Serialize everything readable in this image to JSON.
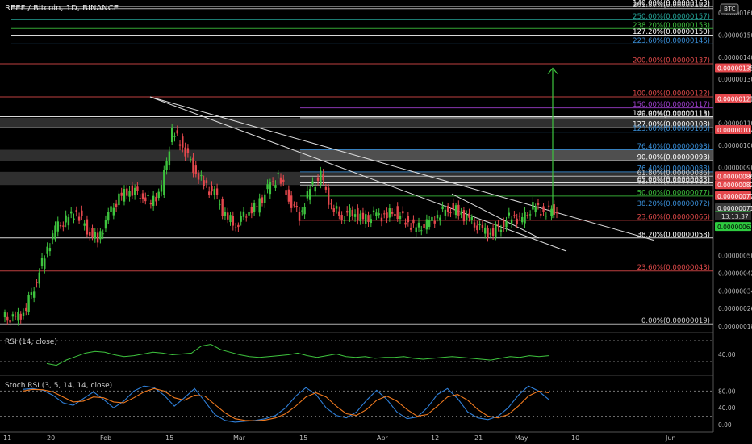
{
  "header": {
    "symbol": "REEF / Bitcoin, 1D, BINANCE",
    "currency": "BTC",
    "countdown": "13:13:37"
  },
  "colors": {
    "background": "#000000",
    "up": "#26a69a",
    "upBright": "#3ec43e",
    "down": "#e5484d",
    "fib": "#e04a4a",
    "rsi": "#3ec43e",
    "stochK": "#2f7fd8",
    "stochD": "#f07a1f",
    "target": "#3ec43e"
  },
  "chart_data": [
    {
      "type": "candlestick",
      "title": "REEF / Bitcoin, 1D, BINANCE",
      "xlabels": [
        "11",
        "20",
        "Feb",
        "15",
        "Mar",
        "15",
        "Apr",
        "12",
        "21",
        "May",
        "10",
        "Jun"
      ],
      "yticks": [
        "0.00000160",
        "0.00000150",
        "0.00000140",
        "0.00000130",
        "0.00000110",
        "0.00000100",
        "0.00000090",
        "0.00000050",
        "0.00000042",
        "0.00000034",
        "0.00000026",
        "0.00000018"
      ],
      "ylim": [
        1.8e-07,
        1.63e-06
      ],
      "price_tags": [
        {
          "value": "0.00000135",
          "color": "#e5484d"
        },
        {
          "value": "0.00000121",
          "color": "#e5484d"
        },
        {
          "value": "0.00000107",
          "color": "#e5484d"
        },
        {
          "value": "0.00000086",
          "color": "#e5484d"
        },
        {
          "value": "0.00000082",
          "color": "#e5484d"
        },
        {
          "value": "0.00000077",
          "color": "#e5484d"
        },
        {
          "value": "0.00000071",
          "color": "#3a3a3a"
        },
        {
          "value": "0.00000068",
          "color": "#2ecc40"
        },
        {
          "value": "0.00000063",
          "color": "#2ecc40"
        }
      ],
      "fib_levels": [
        {
          "label": "140.00%(0.00000163)",
          "value": 1.63e-06,
          "color": "#ffffff"
        },
        {
          "label": "261.80%(0.00000162)",
          "value": 1.62e-06,
          "color": "#d0d0d0"
        },
        {
          "label": "250.00%(0.00000157)",
          "value": 1.57e-06,
          "color": "#26a69a"
        },
        {
          "label": "238.20%(0.00000153)",
          "value": 1.53e-06,
          "color": "#3ec43e"
        },
        {
          "label": "127.20%(0.00000150)",
          "value": 1.5e-06,
          "color": "#ffffff"
        },
        {
          "label": "223.60%(0.00000146)",
          "value": 1.46e-06,
          "color": "#3a8fd8"
        },
        {
          "label": "200.00%(0.00000137)",
          "value": 1.37e-06,
          "color": "#e04a4a"
        },
        {
          "label": "100.00%(0.00000122)",
          "value": 1.22e-06,
          "color": "#e04a4a"
        },
        {
          "label": "150.00%(0.00000117)",
          "value": 1.17e-06,
          "color": "#a040d0"
        },
        {
          "label": "140.00%(0.00000113)",
          "value": 1.13e-06,
          "color": "#ffffff"
        },
        {
          "label": "78.60%(0.00000113)",
          "value": 1.125e-06,
          "color": "#d0d0d0"
        },
        {
          "label": "127.00%(0.00000108)",
          "value": 1.08e-06,
          "color": "#ffffff"
        },
        {
          "label": "123.60%(0.00000106)",
          "value": 1.06e-06,
          "color": "#3a8fd8"
        },
        {
          "label": "76.40%(0.00000098)",
          "value": 9.8e-07,
          "color": "#3a8fd8"
        },
        {
          "label": "90.00%(0.00000093)",
          "value": 9.3e-07,
          "color": "#ffffff"
        },
        {
          "label": "76.40%(0.00000088)",
          "value": 8.8e-07,
          "color": "#3a8fd8"
        },
        {
          "label": "61.80%(0.00000086)",
          "value": 8.6e-07,
          "color": "#d0d0d0"
        },
        {
          "label": "65.00%(0.00000083)",
          "value": 8.3e-07,
          "color": "#ffffff"
        },
        {
          "label": "61.80%(0.00000082)",
          "value": 8.2e-07,
          "color": "#d0d0d0"
        },
        {
          "label": "50.00%(0.00000077)",
          "value": 7.7e-07,
          "color": "#3ec43e"
        },
        {
          "label": "38.20%(0.00000072)",
          "value": 7.2e-07,
          "color": "#3a8fd8"
        },
        {
          "label": "23.60%(0.00000066)",
          "value": 6.6e-07,
          "color": "#e04a4a"
        },
        {
          "label": "38.20%(0.00000058)",
          "value": 5.8e-07,
          "color": "#ffffff"
        },
        {
          "label": "23.60%(0.00000043)",
          "value": 4.3e-07,
          "color": "#e04a4a"
        },
        {
          "label": "0.00%(0.00000019)",
          "value": 1.9e-07,
          "color": "#d0d0d0"
        }
      ],
      "price_path": [
        2.2e-07,
        2.1e-07,
        2.4e-07,
        3.6e-07,
        5e-07,
        6.2e-07,
        6.6e-07,
        7e-07,
        6.2e-07,
        5.7e-07,
        6.8e-07,
        7.6e-07,
        8e-07,
        7.8e-07,
        7.4e-07,
        8e-07,
        1.06e-06,
        1e-06,
        9e-07,
        8.2e-07,
        7.8e-07,
        6.8e-07,
        6.4e-07,
        7e-07,
        7.2e-07,
        8e-07,
        8.6e-07,
        7.6e-07,
        6.8e-07,
        8e-07,
        8.6e-07,
        7.2e-07,
        6.8e-07,
        7e-07,
        6.6e-07,
        6.8e-07,
        6.8e-07,
        7e-07,
        6.6e-07,
        6.2e-07,
        6.4e-07,
        6.8e-07,
        7.2e-07,
        7e-07,
        6.6e-07,
        6.2e-07,
        6e-07,
        6.4e-07,
        6.8e-07,
        6.6e-07,
        7.2e-07,
        7e-07,
        7.1e-07
      ]
    },
    {
      "type": "line",
      "title": "RSI (14, close)",
      "yticks": [
        "40.00"
      ],
      "series": [
        {
          "name": "RSI",
          "values": [
            42,
            40,
            46,
            50,
            54,
            56,
            55,
            52,
            50,
            51,
            53,
            55,
            54,
            52,
            53,
            54,
            62,
            64,
            58,
            55,
            52,
            50,
            49,
            50,
            51,
            52,
            54,
            51,
            49,
            51,
            53,
            50,
            49,
            50,
            48,
            49,
            49,
            50,
            48,
            47,
            48,
            49,
            50,
            49,
            48,
            47,
            46,
            48,
            50,
            49,
            51,
            50,
            51
          ]
        }
      ]
    },
    {
      "type": "line",
      "title": "Stoch RSI (3, 5, 14, 14, close)",
      "yticks": [
        "80.00",
        "40.00",
        "0.00"
      ],
      "ylim": [
        0,
        100
      ],
      "series": [
        {
          "name": "K",
          "values": [
            84,
            86,
            82,
            70,
            52,
            46,
            62,
            78,
            60,
            40,
            56,
            80,
            92,
            88,
            70,
            44,
            64,
            86,
            56,
            24,
            10,
            6,
            8,
            10,
            14,
            22,
            40,
            68,
            88,
            72,
            40,
            22,
            16,
            30,
            58,
            82,
            60,
            30,
            14,
            18,
            40,
            72,
            86,
            62,
            30,
            16,
            12,
            20,
            40,
            70,
            92,
            80,
            60
          ]
        },
        {
          "name": "D",
          "values": [
            80,
            84,
            83,
            78,
            66,
            54,
            56,
            66,
            64,
            54,
            52,
            64,
            78,
            86,
            80,
            64,
            58,
            70,
            68,
            48,
            28,
            14,
            10,
            9,
            11,
            16,
            26,
            44,
            66,
            76,
            66,
            44,
            26,
            22,
            36,
            58,
            68,
            56,
            36,
            20,
            24,
            44,
            66,
            72,
            58,
            36,
            20,
            16,
            24,
            44,
            68,
            80,
            76
          ]
        }
      ]
    }
  ]
}
